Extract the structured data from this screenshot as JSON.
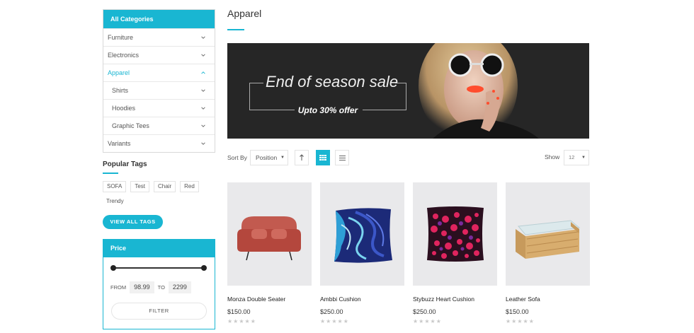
{
  "sidebar": {
    "categories_title": "All Categories",
    "categories": [
      {
        "label": "Furniture",
        "icon": "chevron-down-icon"
      },
      {
        "label": "Electronics",
        "icon": "chevron-down-icon"
      },
      {
        "label": "Apparel",
        "icon": "chevron-up-icon",
        "active": true
      },
      {
        "label": "Shirts",
        "icon": "chevron-down-icon",
        "sub": true
      },
      {
        "label": "Hoodies",
        "icon": "chevron-down-icon",
        "sub": true
      },
      {
        "label": "Graphic Tees",
        "icon": "chevron-down-icon",
        "sub": true
      },
      {
        "label": "Variants",
        "icon": "chevron-down-icon"
      }
    ],
    "tags_title": "Popular Tags",
    "tags": [
      "SOFA",
      "Test",
      "Chair",
      "Red",
      "Trendy"
    ],
    "view_all_tags": "VIEW ALL TAGS",
    "price": {
      "title": "Price",
      "from_label": "FROM",
      "from_value": "98.99",
      "to_label": "TO",
      "to_value": "2299",
      "filter_label": "FILTER"
    }
  },
  "main": {
    "title": "Apparel",
    "banner": {
      "title": "End of season sale",
      "subtitle": "Upto 30% offer"
    },
    "toolbar": {
      "sort_label": "Sort By",
      "sort_value": "Position",
      "show_label": "Show",
      "show_value": "12",
      "grid_view_active": true
    },
    "products": [
      {
        "name": "Monza Double Seater",
        "price": "$150.00",
        "rating": 0
      },
      {
        "name": "Ambbi Cushion",
        "price": "$250.00",
        "rating": 0
      },
      {
        "name": "Stybuzz Heart Cushion",
        "price": "$250.00",
        "rating": 0
      },
      {
        "name": "Leather Sofa",
        "price": "$150.00",
        "rating": 0
      }
    ]
  },
  "colors": {
    "accent": "#19b6d2",
    "banner_bg": "#262626",
    "product_bg": "#e9e9eb"
  }
}
